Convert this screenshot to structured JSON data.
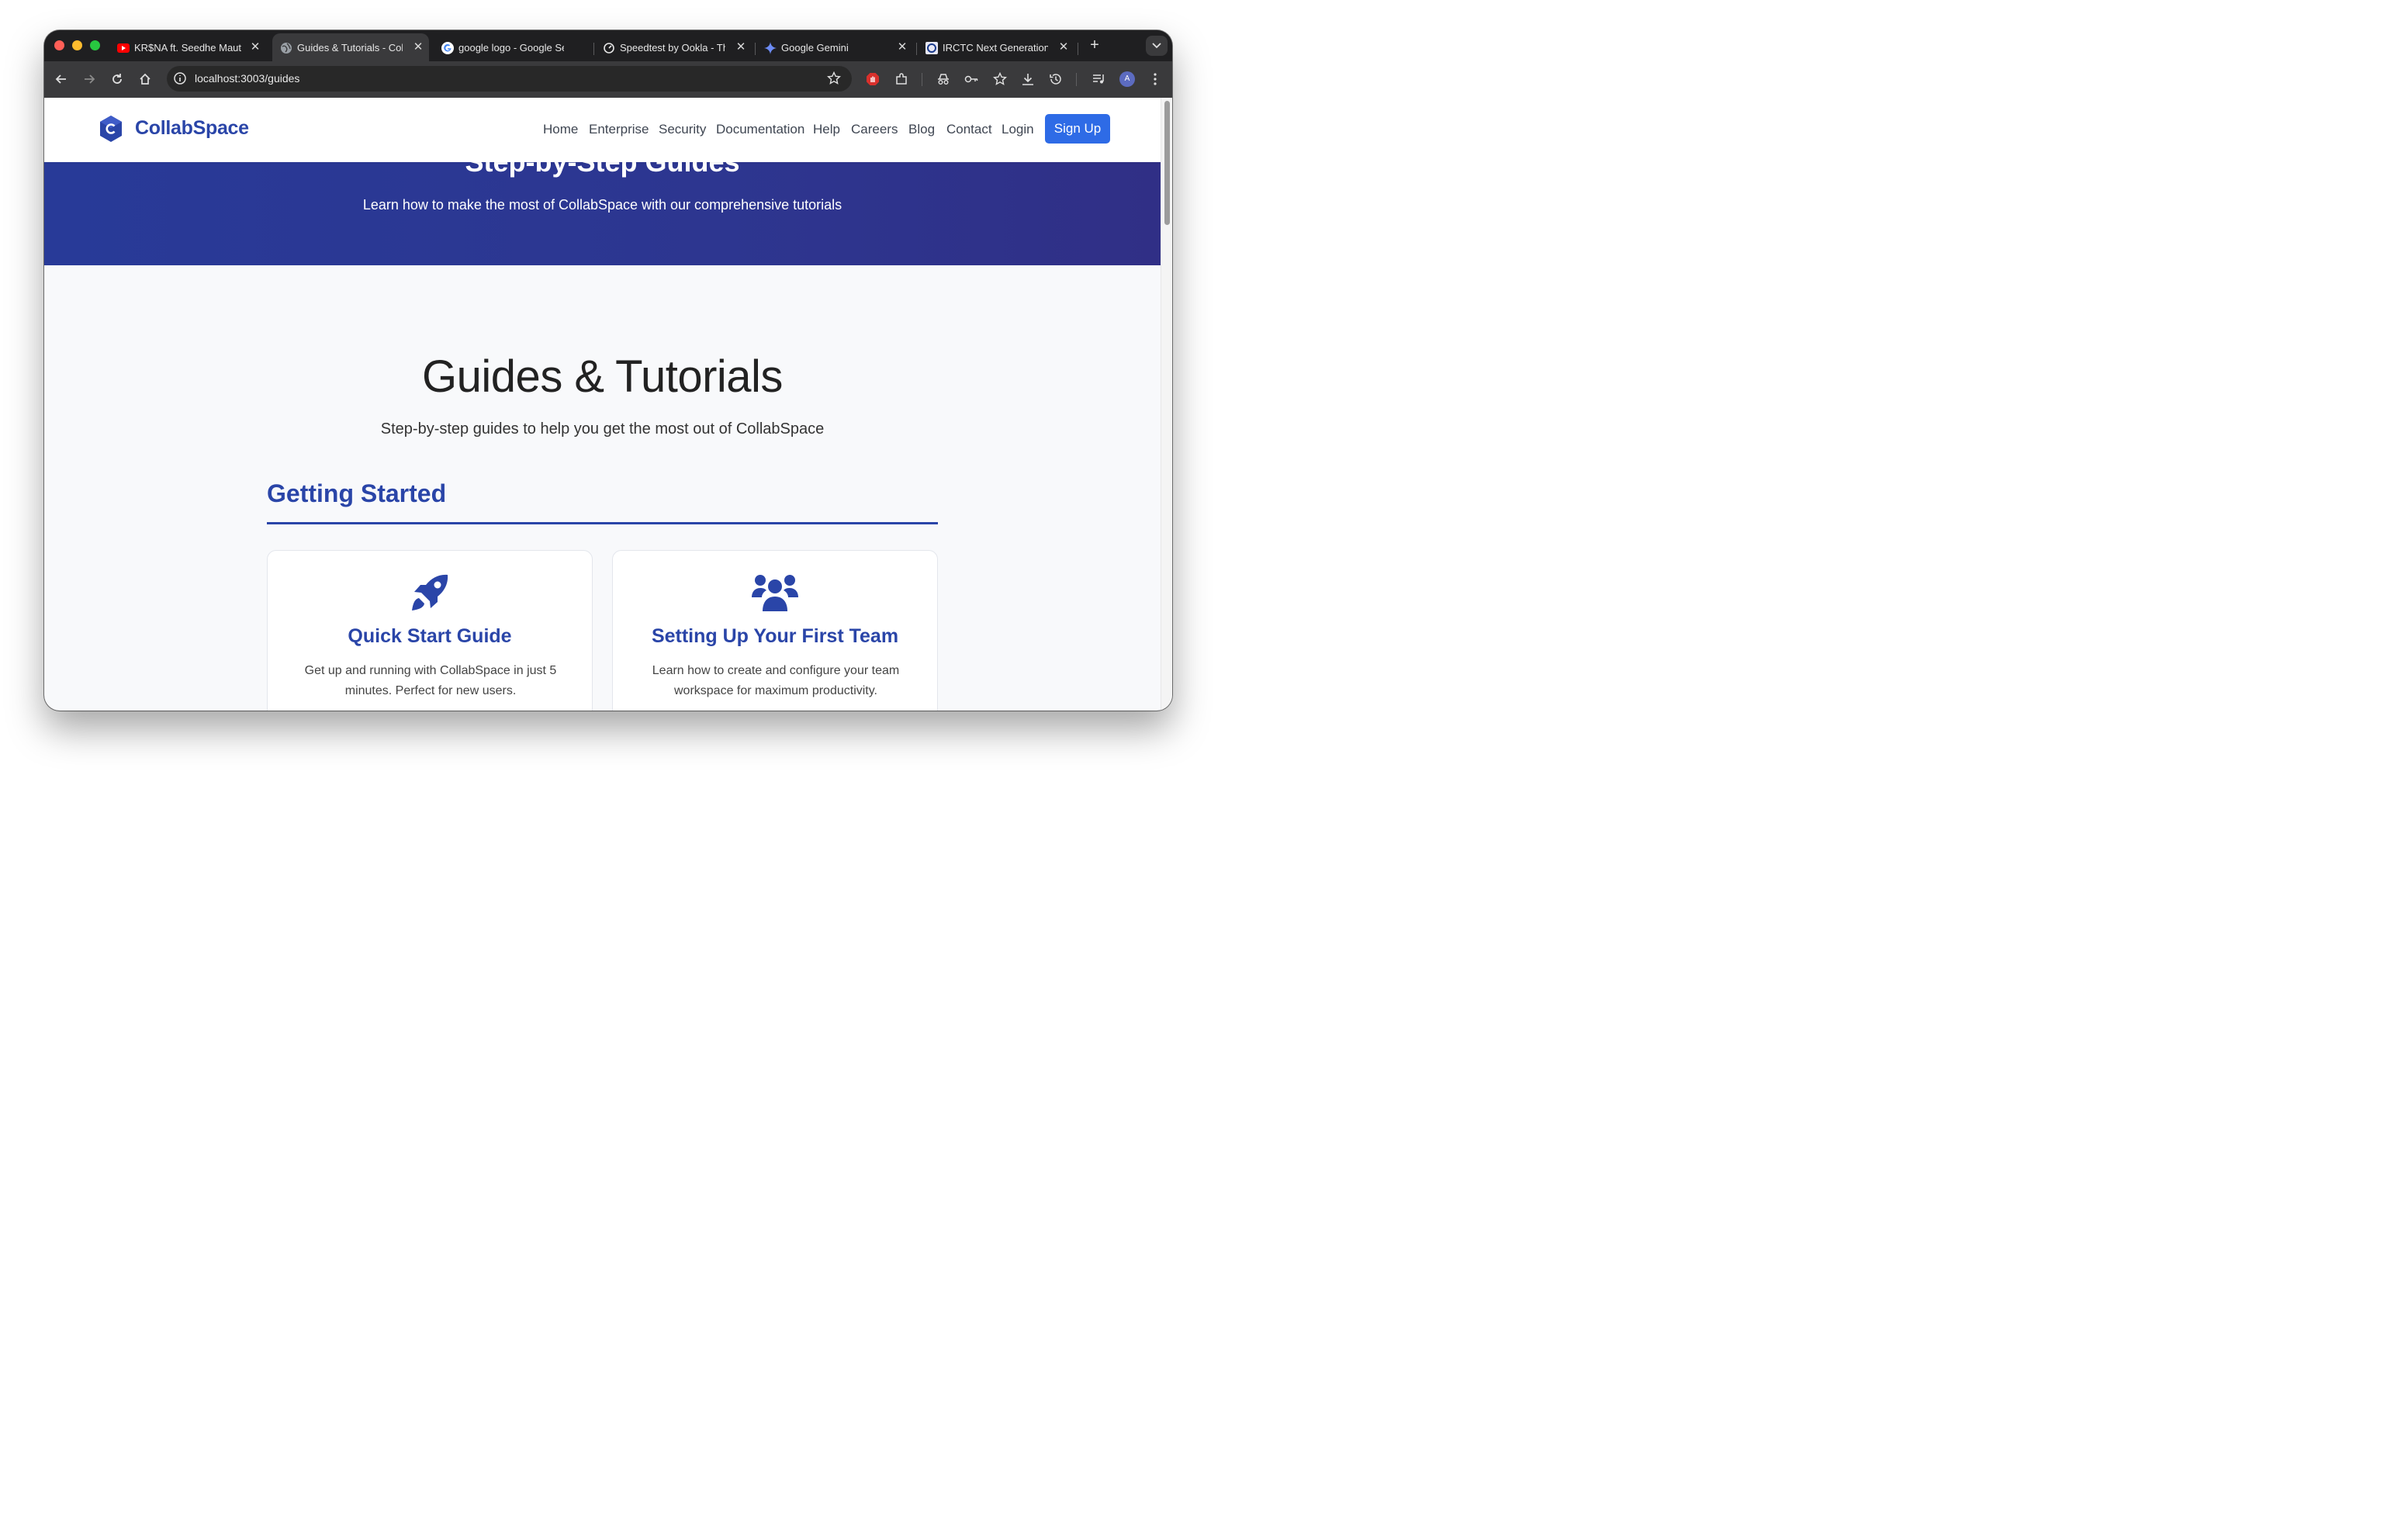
{
  "browser": {
    "tabs": [
      {
        "title": "KR$NA ft. Seedhe Maut",
        "icon": "youtube-icon"
      },
      {
        "title": "Guides & Tutorials - Coll",
        "icon": "globe-icon",
        "active": true
      },
      {
        "title": "google logo - Google Se",
        "icon": "google-icon"
      },
      {
        "title": "Speedtest by Ookla - Th",
        "icon": "speedtest-icon"
      },
      {
        "title": "Google Gemini",
        "icon": "gemini-icon"
      },
      {
        "title": "IRCTC Next Generation",
        "icon": "irctc-icon"
      }
    ],
    "url": "localhost:3003/guides",
    "profile_initial": "A"
  },
  "site": {
    "brand": "CollabSpace",
    "nav": [
      "Home",
      "Enterprise",
      "Security",
      "Documentation",
      "Help",
      "Careers",
      "Blog",
      "Contact",
      "Login"
    ],
    "signup": "Sign Up"
  },
  "hero": {
    "title": "Step-by-Step Guides",
    "subtitle": "Learn how to make the most of CollabSpace with our comprehensive tutorials"
  },
  "main": {
    "title": "Guides & Tutorials",
    "subtitle": "Step-by-step guides to help you get the most out of CollabSpace",
    "section": {
      "title": "Getting Started",
      "cards": [
        {
          "icon": "rocket-icon",
          "title": "Quick Start Guide",
          "desc": "Get up and running with CollabSpace in just 5 minutes. Perfect for new users."
        },
        {
          "icon": "users-icon",
          "title": "Setting Up Your First Team",
          "desc": "Learn how to create and configure your team workspace for maximum productivity."
        }
      ]
    }
  },
  "colors": {
    "brand": "#2a45a8",
    "hero_bg": "#2d3690",
    "signup_bg": "#2e6be6"
  }
}
